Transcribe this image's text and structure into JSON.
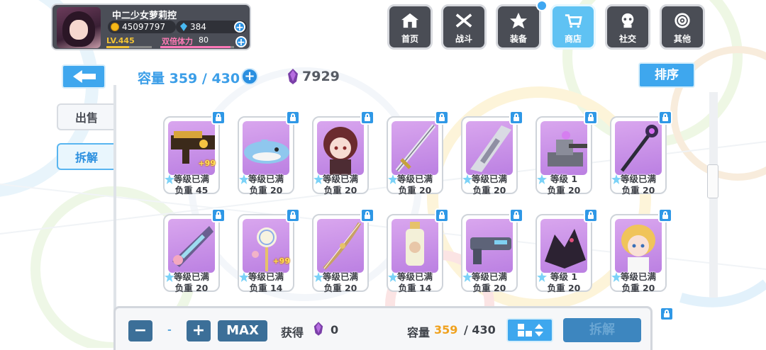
{
  "player": {
    "name": "中二少女萝莉控",
    "gold": "45097797",
    "gems": "384",
    "level": "LV.445",
    "level_progress": 0.5,
    "stamina_label": "双倍体力",
    "stamina": "80",
    "stamina_progress": 0.95,
    "plus": "+"
  },
  "nav": [
    {
      "label": "首页",
      "icon": "home-icon"
    },
    {
      "label": "战斗",
      "icon": "battle-icon"
    },
    {
      "label": "装备",
      "icon": "equipment-icon"
    },
    {
      "label": "商店",
      "icon": "shop-icon",
      "active": true
    },
    {
      "label": "社交",
      "icon": "social-icon"
    },
    {
      "label": "其他",
      "icon": "other-icon"
    }
  ],
  "side_tabs": {
    "sell": "出售",
    "dismantle": "拆解"
  },
  "capacity": {
    "label": "容量",
    "used": "359",
    "total": "430",
    "display": "容量 359 / 430"
  },
  "crystals": "7929",
  "sort_label": "排序",
  "items": [
    {
      "status": "等级已满",
      "weight": "负重 45",
      "badge": "+99",
      "art": "gun-gold"
    },
    {
      "status": "等级已满",
      "weight": "负重 20",
      "badge": "",
      "art": "shark"
    },
    {
      "status": "等级已满",
      "weight": "负重 20",
      "badge": "",
      "art": "girl-dark"
    },
    {
      "status": "等级已满",
      "weight": "负重 20",
      "badge": "",
      "art": "sword"
    },
    {
      "status": "等级已满",
      "weight": "负重 20",
      "badge": "",
      "art": "blade-silver"
    },
    {
      "status": "等级 1",
      "weight": "负重 20",
      "badge": "",
      "art": "turret"
    },
    {
      "status": "等级已满",
      "weight": "负重 20",
      "badge": "",
      "art": "scepter"
    },
    {
      "status": "等级已满",
      "weight": "负重 20",
      "badge": "",
      "art": "blade-purple"
    },
    {
      "status": "等级已满",
      "weight": "负重 14",
      "badge": "+99",
      "art": "clock-staff"
    },
    {
      "status": "等级已满",
      "weight": "负重 20",
      "badge": "",
      "art": "bow"
    },
    {
      "status": "等级已满",
      "weight": "负重 14",
      "badge": "",
      "art": "bottle"
    },
    {
      "status": "等级已满",
      "weight": "负重 20",
      "badge": "",
      "art": "blaster"
    },
    {
      "status": "等级 1",
      "weight": "负重 20",
      "badge": "",
      "art": "dark-beast"
    },
    {
      "status": "等级已满",
      "weight": "负重 20",
      "badge": "",
      "art": "girl-blonde"
    }
  ],
  "bottom": {
    "minus": "−",
    "quantity": "-",
    "plus": "+",
    "max": "MAX",
    "gain_label": "获得",
    "gain_value": "0",
    "cap_label": "容量",
    "cap_used": "359",
    "cap_total": "/ 430",
    "dismantle": "拆解"
  },
  "colors": {
    "accent": "#3ea7ee",
    "item_bg": "#c890e8",
    "gold_text": "#f0a21f",
    "stamina": "#ff78b8"
  }
}
